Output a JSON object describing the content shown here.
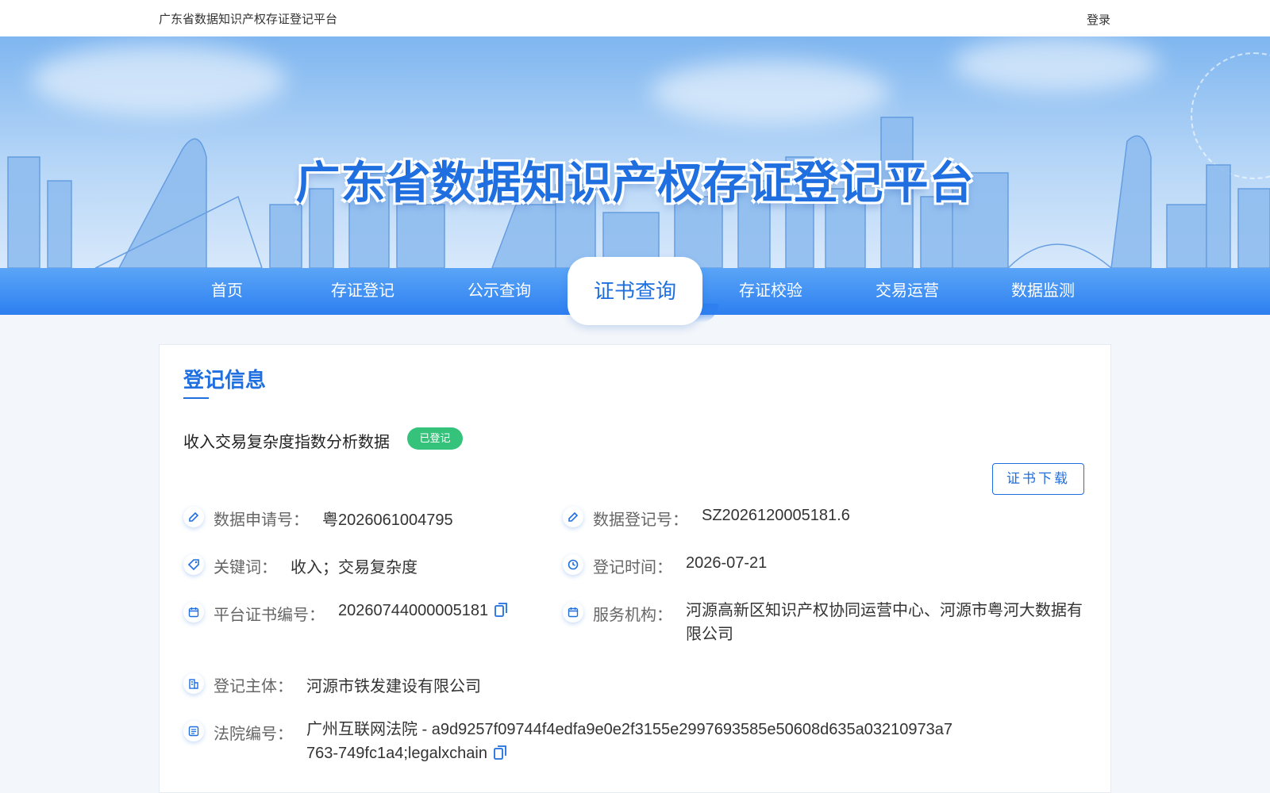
{
  "topbar": {
    "site_name": "广东省数据知识产权存证登记平台",
    "login": "登录"
  },
  "banner": {
    "title": "广东省数据知识产权存证登记平台"
  },
  "nav": {
    "items": [
      {
        "label": "首页",
        "active": false
      },
      {
        "label": "存证登记",
        "active": false
      },
      {
        "label": "公示查询",
        "active": false
      },
      {
        "label": "证书查询",
        "active": true
      },
      {
        "label": "存证校验",
        "active": false
      },
      {
        "label": "交易运营",
        "active": false
      },
      {
        "label": "数据监测",
        "active": false
      }
    ]
  },
  "card": {
    "section_title": "登记信息",
    "data_title": "收入交易复杂度指数分析数据",
    "status_badge": "已登记",
    "download_button": "证书下载",
    "fields": {
      "application_no": {
        "label": "数据申请号：",
        "value": "粤2026061004795"
      },
      "registration_no": {
        "label": "数据登记号：",
        "value": "SZ2026120005181.6"
      },
      "keywords": {
        "label": "关键词：",
        "value": "收入；交易复杂度"
      },
      "registration_time": {
        "label": "登记时间：",
        "value": "2026-07-21"
      },
      "certificate_no": {
        "label": "平台证书编号：",
        "value": "20260744000005181"
      },
      "service_org": {
        "label": "服务机构：",
        "value": "河源高新区知识产权协同运营中心、河源市粤河大数据有限公司"
      },
      "subject": {
        "label": "登记主体：",
        "value": "河源市铁发建设有限公司"
      },
      "court_no": {
        "label": "法院编号：",
        "value": "广州互联网法院 - a9d9257f09744f4edfa9e0e2f3155e2997693585e50608d635a03210973a7763-749fc1a4;legalxchain"
      }
    }
  },
  "colors": {
    "accent": "#1f6fe0",
    "nav_bg": "#2d7ff0",
    "badge_green": "#35c27a"
  }
}
